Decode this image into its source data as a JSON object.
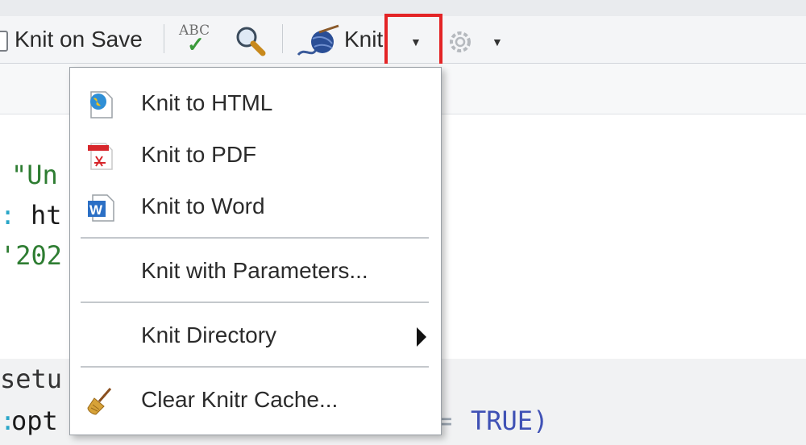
{
  "toolbar": {
    "knit_on_save_label": "Knit on Save",
    "spellcheck_text": "ABC",
    "knit_label": "Knit"
  },
  "editor": {
    "line1": "\"Un",
    "line2_colon": ":",
    "line2": "ht",
    "line3": "'202",
    "line4": "setu",
    "line5_colon": ":",
    "line5": "opt",
    "line5_eq": "=",
    "line5_value": "TRUE)"
  },
  "knit_menu": {
    "items": [
      {
        "label": "Knit to HTML",
        "icon": "globe-page-icon"
      },
      {
        "label": "Knit to PDF",
        "icon": "pdf-icon"
      },
      {
        "label": "Knit to Word",
        "icon": "word-icon"
      },
      {
        "label": "Knit with Parameters..."
      },
      {
        "label": "Knit Directory",
        "icon": "submenu-arrow-icon"
      },
      {
        "label": "Clear Knitr Cache...",
        "icon": "broom-icon"
      }
    ]
  },
  "colors": {
    "highlight_box": "#e32426",
    "string_green": "#2e7d32",
    "keyword_blue": "#3f51b5"
  }
}
